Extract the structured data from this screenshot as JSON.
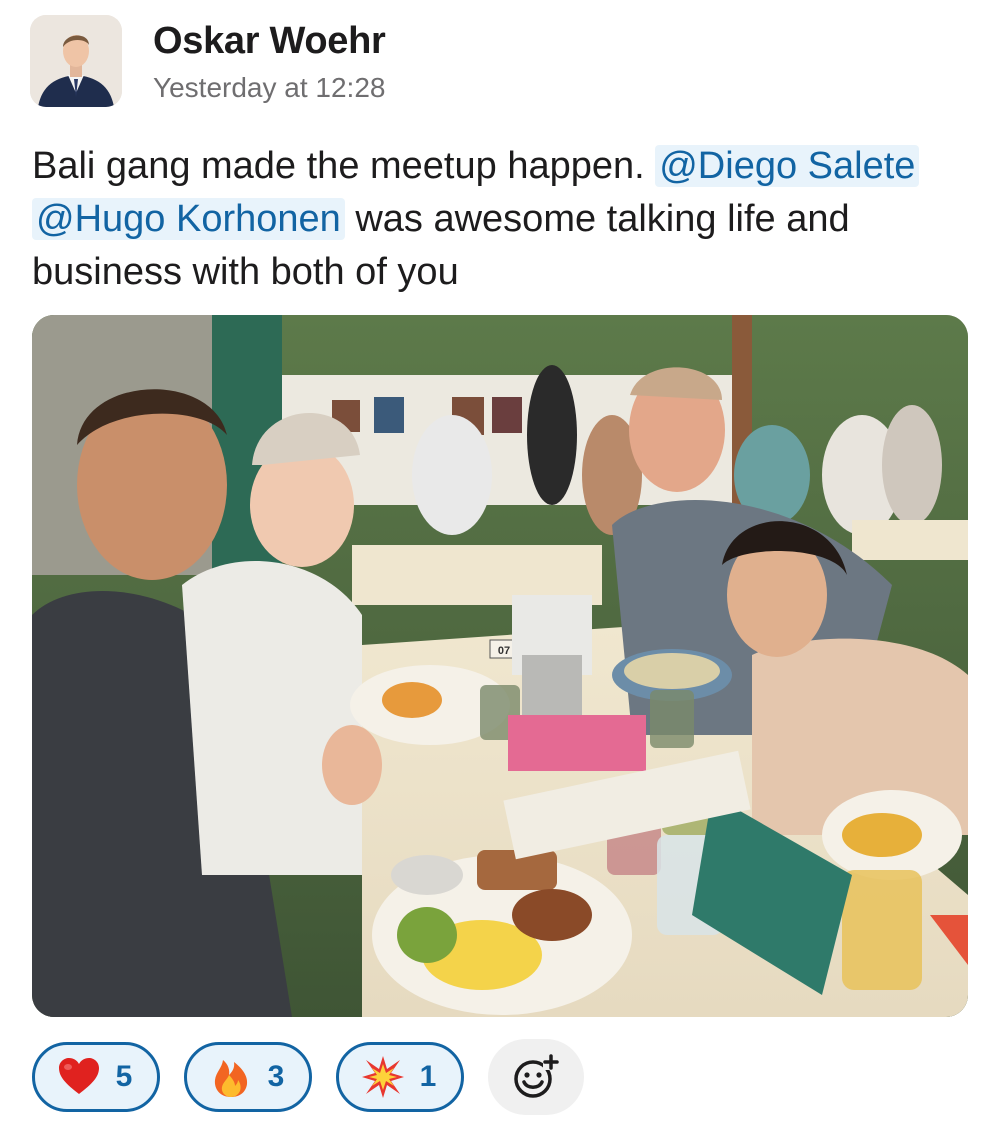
{
  "post": {
    "author": "Oskar Woehr",
    "timestamp": "Yesterday at 12:28",
    "message": {
      "text_before": "Bali gang made the meetup happen. ",
      "mention_1": "@Diego Salete",
      "between": " ",
      "mention_2": "@Hugo Korhonen",
      "text_after": " was awesome talking life and business with both of you"
    },
    "photo": {
      "icon": "group-photo-image",
      "table_number": "07"
    }
  },
  "reactions": [
    {
      "emoji": "heart-icon",
      "count": "5"
    },
    {
      "emoji": "fire-icon",
      "count": "3"
    },
    {
      "emoji": "collision-icon",
      "count": "1"
    }
  ],
  "add_reaction": {
    "icon": "add-reaction-icon"
  },
  "colors": {
    "mention_text": "#1264a3",
    "mention_bg": "#e8f3fb",
    "reaction_border": "#1264a3",
    "reaction_bg": "#e8f3fb",
    "timestamp": "#6f6e70"
  }
}
